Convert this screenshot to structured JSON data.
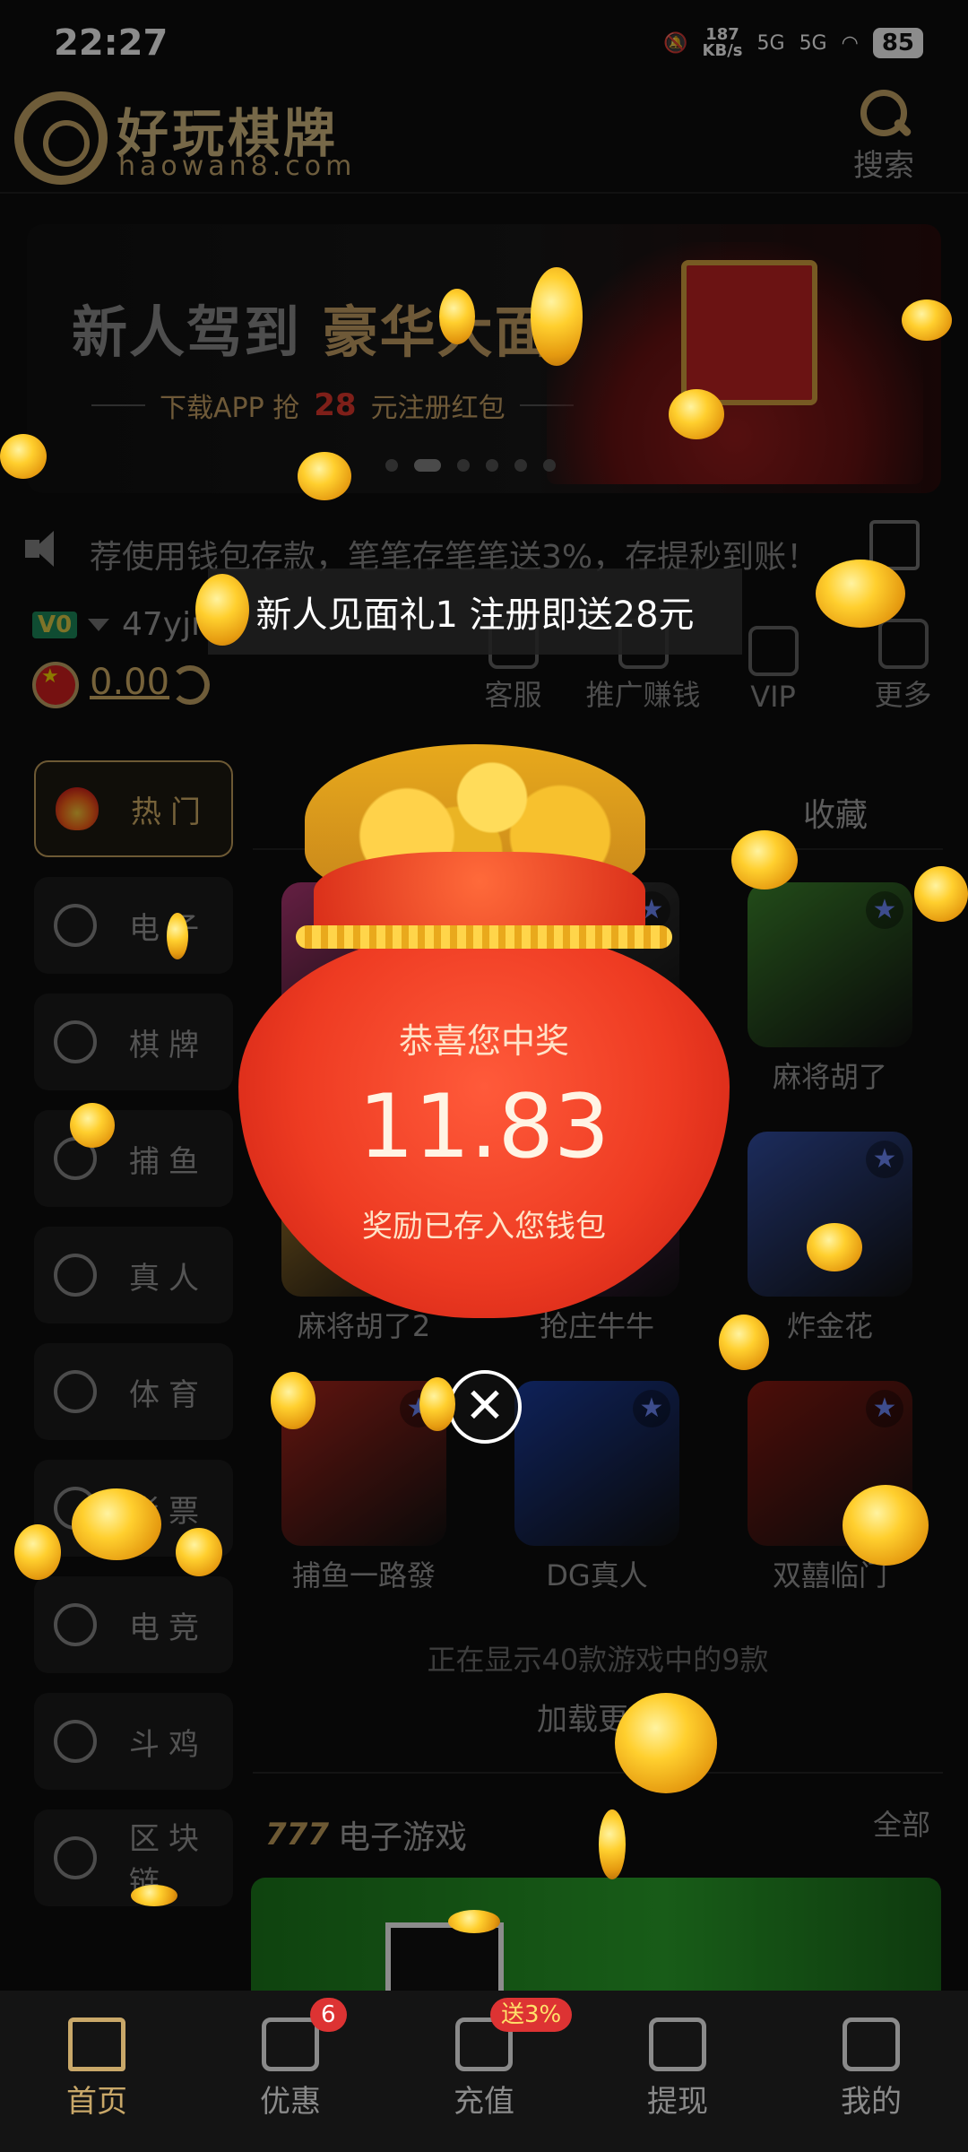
{
  "status_bar": {
    "time": "22:27",
    "net_speed_value": "187",
    "net_speed_unit": "KB/s",
    "signal1": "5G",
    "signal2": "5G",
    "battery": "85"
  },
  "header": {
    "logo_title": "好玩棋牌",
    "logo_subtitle": "haowan8.com",
    "search_label": "搜索"
  },
  "banner": {
    "title_part1": "新人驾到",
    "title_part2": "豪华大面",
    "line_prefix": "下载APP  抢",
    "line_amount": "28",
    "line_suffix": "元注册红包",
    "active_dot": 1,
    "dot_count": 6
  },
  "marquee": {
    "text": "荐使用钱包存款，笔笔存笔笔送3%，存提秒到账！"
  },
  "user": {
    "vip_level": "V0",
    "username": "47yjm",
    "balance": "0.00"
  },
  "quick_actions": [
    {
      "label": "客服",
      "icon": "headset-icon"
    },
    {
      "label": "推广赚钱",
      "icon": "coins-icon"
    },
    {
      "label": "VIP",
      "icon": "crown-icon"
    },
    {
      "label": "更多",
      "icon": "grid-icon"
    }
  ],
  "categories": [
    {
      "label": "热门",
      "icon": "fire-icon",
      "active": true
    },
    {
      "label": "电子",
      "icon": "slot-777-icon"
    },
    {
      "label": "棋牌",
      "icon": "cards-icon"
    },
    {
      "label": "捕鱼",
      "icon": "fish-icon"
    },
    {
      "label": "真人",
      "icon": "dealer-icon"
    },
    {
      "label": "体育",
      "icon": "soccer-ball-icon"
    },
    {
      "label": "彩票",
      "icon": "lottery-icon"
    },
    {
      "label": "电竞",
      "icon": "versus-icon"
    },
    {
      "label": "斗鸡",
      "icon": "rooster-icon"
    },
    {
      "label": "区块链",
      "icon": "blockchain-icon"
    }
  ],
  "grid": {
    "favorites_tab": "收藏",
    "games": [
      {
        "name": "",
        "color": "#b83a7a"
      },
      {
        "name": "",
        "color": "#3a3a3a"
      },
      {
        "name": "麻将胡了",
        "color": "#3f8a2e"
      },
      {
        "name": "麻将胡了2",
        "color": "#b9882f"
      },
      {
        "name": "抢庄牛牛",
        "color": "#7a2a7a"
      },
      {
        "name": "炸金花",
        "color": "#3450a8"
      },
      {
        "name": "捕鱼一路發",
        "color": "#b0261c"
      },
      {
        "name": "DG真人",
        "color": "#1b3ea3"
      },
      {
        "name": "双囍临门",
        "color": "#8c1a12"
      }
    ],
    "showing_text": "正在显示40款游戏中的9款",
    "load_more": "加载更多"
  },
  "section": {
    "icon_text": "777",
    "title": "电子游戏",
    "all_label": "全部"
  },
  "overlay": {
    "gift_title": "新人见面礼1  注册即送28元",
    "caption": "恭喜您中奖",
    "amount": "11.83",
    "note": "奖励已存入您钱包",
    "close_symbol": "✕"
  },
  "bottom_nav": [
    {
      "label": "首页",
      "icon": "home-icon",
      "active": true
    },
    {
      "label": "优惠",
      "icon": "gift-icon",
      "badge": "6"
    },
    {
      "label": "充值",
      "icon": "wallet-icon",
      "badge": "送3%"
    },
    {
      "label": "提现",
      "icon": "withdraw-icon"
    },
    {
      "label": "我的",
      "icon": "user-icon"
    }
  ],
  "colors": {
    "gold": "#c9a869",
    "background": "#0d0d0d",
    "bag_red": "#ee3b22"
  }
}
